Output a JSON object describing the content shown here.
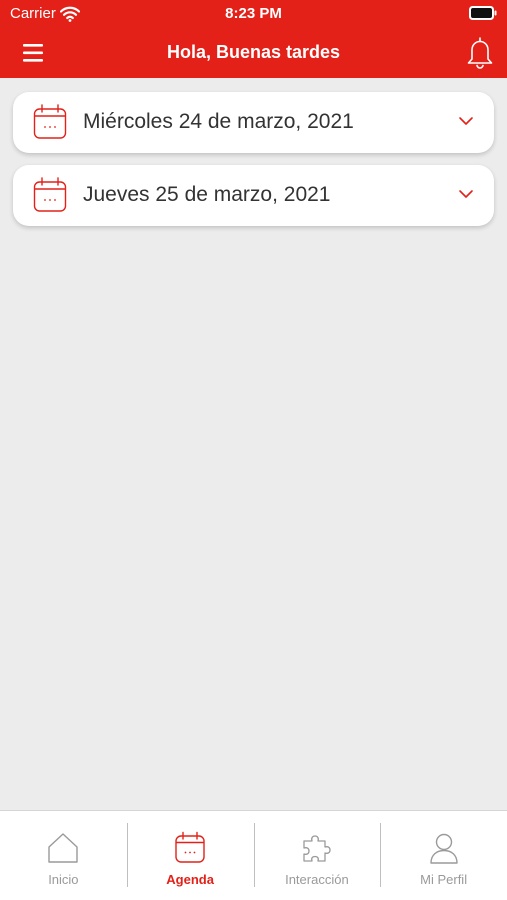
{
  "status_bar": {
    "carrier": "Carrier",
    "time": "8:23 PM"
  },
  "nav": {
    "title": "Hola, Buenas tardes"
  },
  "agenda": {
    "days": [
      {
        "label": "Miércoles 24 de marzo, 2021"
      },
      {
        "label": "Jueves 25 de marzo, 2021"
      }
    ]
  },
  "tab_bar": {
    "items": [
      {
        "label": "Inicio",
        "icon": "home-icon"
      },
      {
        "label": "Agenda",
        "icon": "calendar-icon",
        "active": true
      },
      {
        "label": "Interacción",
        "icon": "puzzle-icon"
      },
      {
        "label": "Mi Perfil",
        "icon": "user-icon"
      }
    ]
  },
  "colors": {
    "brand": "#e32119",
    "background": "#ececec",
    "inactive": "#9a9a9a"
  }
}
